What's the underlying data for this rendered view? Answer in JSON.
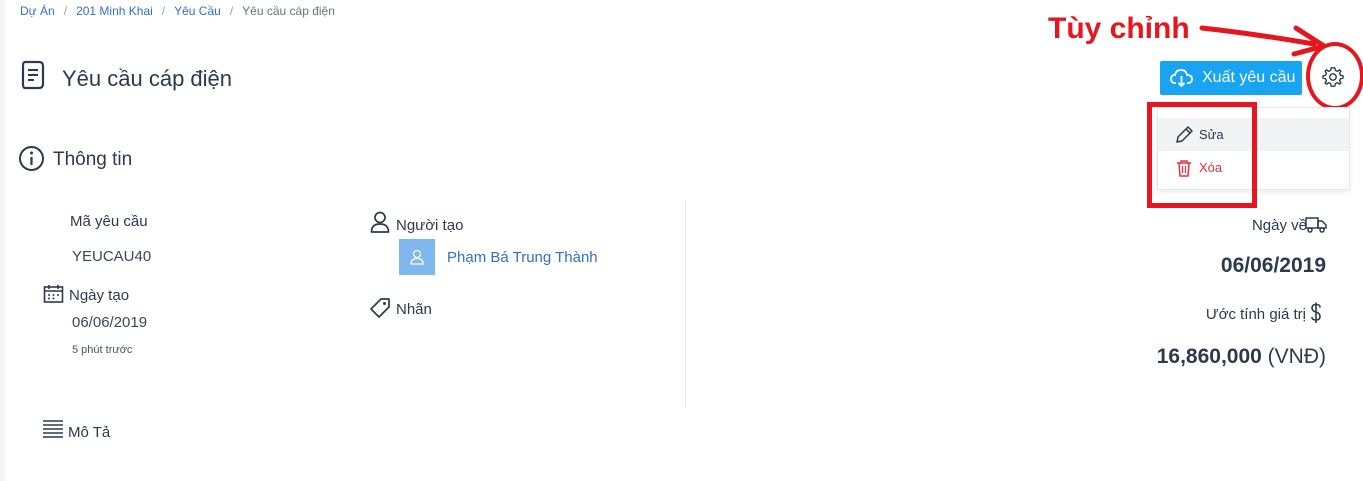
{
  "breadcrumb": {
    "items": [
      "Dự Án",
      "201 Minh Khai",
      "Yêu Cầu"
    ],
    "current": "Yêu cầu cáp điện",
    "separator": "/"
  },
  "header": {
    "title": "Yêu cầu cáp điện",
    "export_label": "Xuất yêu cầu"
  },
  "annotation": {
    "label": "Tùy chỉnh",
    "color": "#e5161d"
  },
  "menu": {
    "edit_label": "Sửa",
    "delete_label": "Xóa"
  },
  "info": {
    "section_title": "Thông tin",
    "code_label": "Mã yêu cầu",
    "code_value": "YEUCAU40",
    "created_label": "Ngày tạo",
    "created_value": "06/06/2019",
    "created_relative": "5 phút trước",
    "creator_label": "Người tạo",
    "creator_name": "Phạm Bá Trung Thành",
    "tag_label": "Nhãn",
    "arrival_label": "Ngày về",
    "arrival_value": "06/06/2019",
    "estimate_label": "Ước tính giá trị",
    "estimate_value": "16,860,000",
    "estimate_unit": "(VNĐ)",
    "description_label": "Mô Tả"
  },
  "colors": {
    "accent": "#19a4f2",
    "link": "#2f6fd1",
    "danger": "#e5313a",
    "avatar_bg": "#7fb7ee"
  },
  "icons": [
    "document-icon",
    "cloud-download-icon",
    "gear-icon",
    "pencil-icon",
    "trash-icon",
    "info-icon",
    "calendar-icon",
    "user-icon",
    "tag-icon",
    "truck-icon",
    "dollar-icon",
    "text-lines-icon"
  ]
}
